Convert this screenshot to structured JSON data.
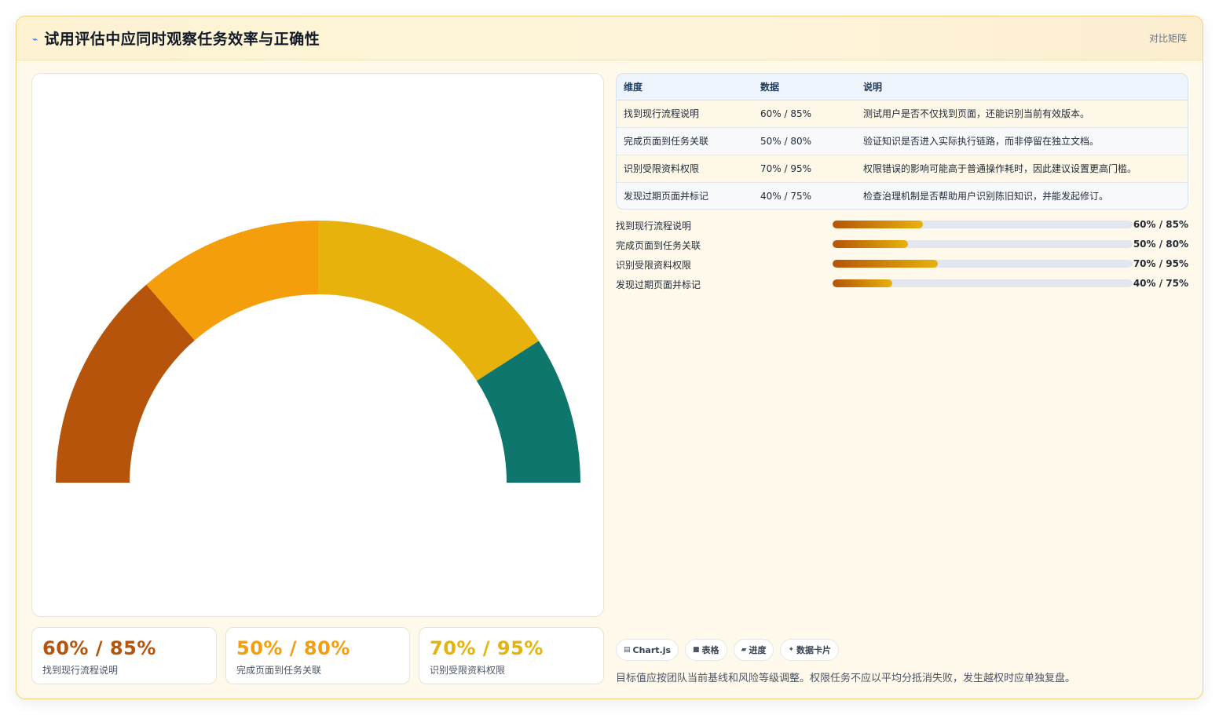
{
  "header": {
    "icon": "sparkline-icon",
    "title": "试用评估中应同时观察任务效率与正确性",
    "right_label": "对比矩阵"
  },
  "chart_data": {
    "type": "doughnut-half",
    "segments": [
      {
        "label": "找到现行流程说明",
        "value": 60,
        "color": "#b5540a"
      },
      {
        "label": "完成页面到任务关联",
        "value": 50,
        "color": "#f59e0b"
      },
      {
        "label": "识别受限资料权限",
        "value": 70,
        "color": "#e7b20c"
      },
      {
        "label": "发现过期页面并标记",
        "value": 40,
        "color": "#0f766e"
      }
    ]
  },
  "stats": [
    {
      "value": "60% / 85%",
      "label": "找到现行流程说明",
      "color": "#b5540a"
    },
    {
      "value": "50% / 80%",
      "label": "完成页面到任务关联",
      "color": "#f59e0b"
    },
    {
      "value": "70% / 95%",
      "label": "识别受限资料权限",
      "color": "#e7b20c"
    }
  ],
  "table": {
    "headers": [
      "维度",
      "数据",
      "说明"
    ],
    "rows": [
      [
        "找到现行流程说明",
        "60% / 85%",
        "测试用户是否不仅找到页面，还能识别当前有效版本。"
      ],
      [
        "完成页面到任务关联",
        "50% / 80%",
        "验证知识是否进入实际执行链路，而非停留在独立文档。"
      ],
      [
        "识别受限资料权限",
        "70% / 95%",
        "权限错误的影响可能高于普通操作耗时，因此建议设置更高门槛。"
      ],
      [
        "发现过期页面并标记",
        "40% / 75%",
        "检查治理机制是否帮助用户识别陈旧知识，并能发起修订。"
      ]
    ]
  },
  "progress": [
    {
      "label": "找到现行流程说明",
      "value_text": "60% / 85%",
      "fill": 0.3
    },
    {
      "label": "完成页面到任务关联",
      "value_text": "50% / 80%",
      "fill": 0.25
    },
    {
      "label": "识别受限资料权限",
      "value_text": "70% / 95%",
      "fill": 0.35
    },
    {
      "label": "发现过期页面并标记",
      "value_text": "40% / 75%",
      "fill": 0.2
    }
  ],
  "tags": [
    {
      "icon": "chart-icon",
      "glyph": "▤",
      "label": "Chart.js"
    },
    {
      "icon": "table-icon",
      "glyph": "■",
      "label": "表格"
    },
    {
      "icon": "progress-icon",
      "glyph": "▰",
      "label": "进度"
    },
    {
      "icon": "data-card-icon",
      "glyph": "✦",
      "label": "数据卡片"
    }
  ],
  "note": "目标值应按团队当前基线和风险等级调整。权限任务不应以平均分抵消失败，发生越权时应单独复盘。"
}
